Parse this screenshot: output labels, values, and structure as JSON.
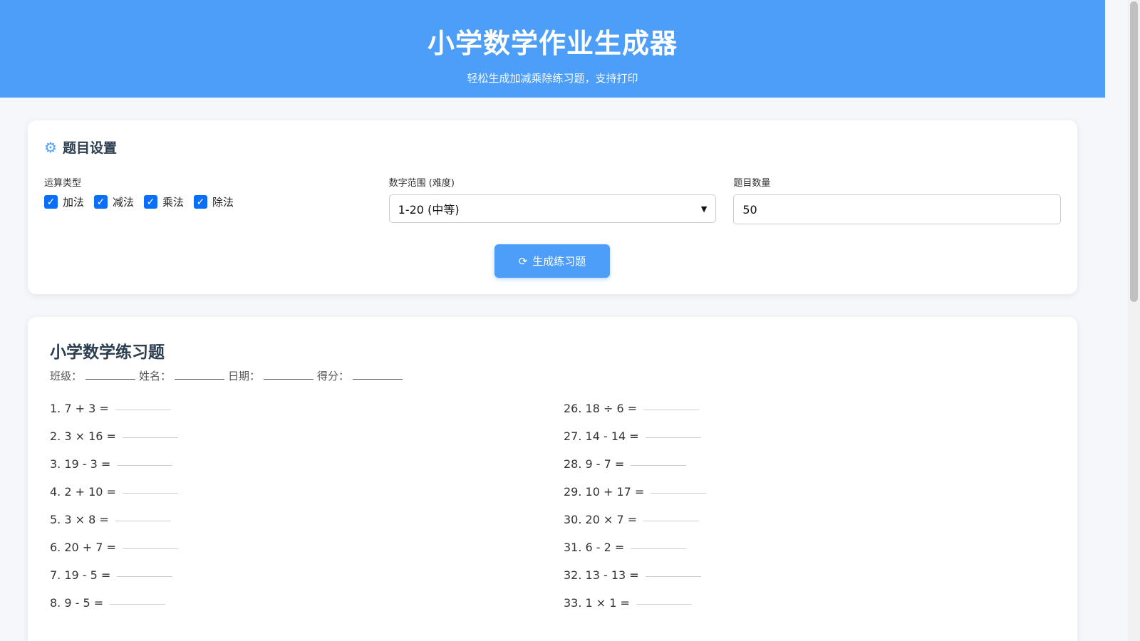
{
  "header": {
    "title": "小学数学作业生成器",
    "subtitle": "轻松生成加减乘除练习题，支持打印"
  },
  "settings": {
    "title": "题目设置",
    "ops_label": "运算类型",
    "ops": [
      {
        "label": "加法",
        "checked": true
      },
      {
        "label": "减法",
        "checked": true
      },
      {
        "label": "乘法",
        "checked": true
      },
      {
        "label": "除法",
        "checked": true
      }
    ],
    "range_label": "数字范围 (难度)",
    "range_value": "1-20 (中等)",
    "count_label": "题目数量",
    "count_value": "50",
    "generate_label": "生成练习题"
  },
  "sheet": {
    "title": "小学数学练习题",
    "fields": [
      "班级：",
      "姓名：",
      "日期：",
      "得分："
    ],
    "left": [
      "1. 7 + 3 =",
      "2. 3 × 16 =",
      "3. 19 - 3 =",
      "4. 2 + 10 =",
      "5. 3 × 8 =",
      "6. 20 + 7 =",
      "7. 19 - 5 =",
      "8. 9 - 5 ="
    ],
    "right": [
      "26. 18 ÷ 6 =",
      "27. 14 - 14 =",
      "28. 9 - 7 =",
      "29. 10 + 17 =",
      "30. 20 × 7 =",
      "31. 6 - 2 =",
      "32. 13 - 13 =",
      "33. 1 × 1 ="
    ]
  }
}
